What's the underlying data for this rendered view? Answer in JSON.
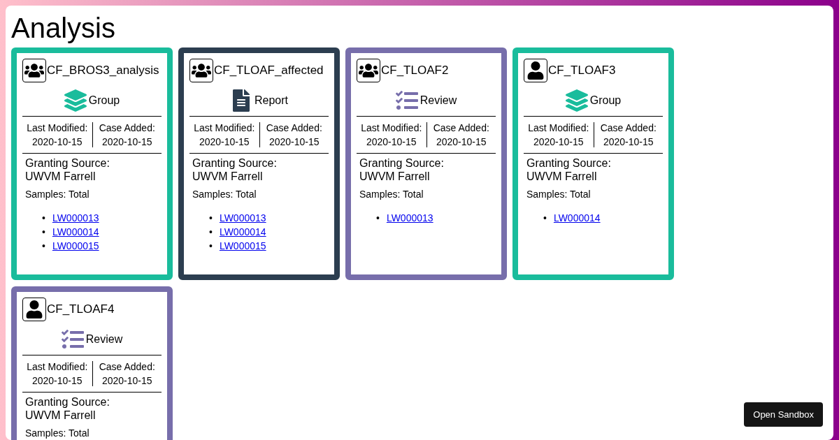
{
  "page_title": "Analysis",
  "cards": [
    {
      "name": "CF_BROS3_analysis",
      "avatar": {
        "kind": "group"
      },
      "kind": "group",
      "type_label": "Group",
      "modified_label": "Last Modified:",
      "modified": "2020-10-15",
      "added_label": "Case Added:",
      "added": "2020-10-15",
      "source_label": "Granting Source:",
      "source": "UWVM Farrell",
      "samples_label": "Samples: Total",
      "samples": [
        {
          "bullet": "•",
          "id": "LW000013"
        },
        {
          "bullet": "•",
          "id": "LW000014"
        },
        {
          "bullet": "•",
          "id": "LW000015"
        }
      ]
    },
    {
      "name": "CF_TLOAF_affected",
      "avatar": {
        "kind": "group"
      },
      "kind": "report",
      "type_label": "Report",
      "modified_label": "Last Modified:",
      "modified": "2020-10-15",
      "added_label": "Case Added:",
      "added": "2020-10-15",
      "source_label": "Granting Source:",
      "source": "UWVM Farrell",
      "samples_label": "Samples: Total",
      "samples": [
        {
          "bullet": "•",
          "id": "LW000013"
        },
        {
          "bullet": "•",
          "id": "LW000014"
        },
        {
          "bullet": "•",
          "id": "LW000015"
        }
      ]
    },
    {
      "name": "CF_TLOAF2",
      "avatar": {
        "kind": "group"
      },
      "kind": "review",
      "type_label": "Review",
      "modified_label": "Last Modified:",
      "modified": "2020-10-15",
      "added_label": "Case Added:",
      "added": "2020-10-15",
      "source_label": "Granting Source:",
      "source": "UWVM Farrell",
      "samples_label": "Samples: Total",
      "samples": [
        {
          "bullet": "•",
          "id": "LW000013"
        }
      ]
    },
    {
      "name": "CF_TLOAF3",
      "avatar": {
        "kind": "person"
      },
      "kind": "group",
      "type_label": "Group",
      "modified_label": "Last Modified:",
      "modified": "2020-10-15",
      "added_label": "Case Added:",
      "added": "2020-10-15",
      "source_label": "Granting Source:",
      "source": "UWVM Farrell",
      "samples_label": "Samples: Total",
      "samples": [
        {
          "bullet": "•",
          "id": "LW000014"
        }
      ]
    },
    {
      "name": "CF_TLOAF4",
      "avatar": {
        "kind": "person"
      },
      "kind": "review",
      "type_label": "Review",
      "modified_label": "Last Modified:",
      "modified": "2020-10-15",
      "added_label": "Case Added:",
      "added": "2020-10-15",
      "source_label": "Granting Source:",
      "source": "UWVM Farrell",
      "samples_label": "Samples: Total"
    }
  ],
  "sandbox_button": "Open Sandbox"
}
